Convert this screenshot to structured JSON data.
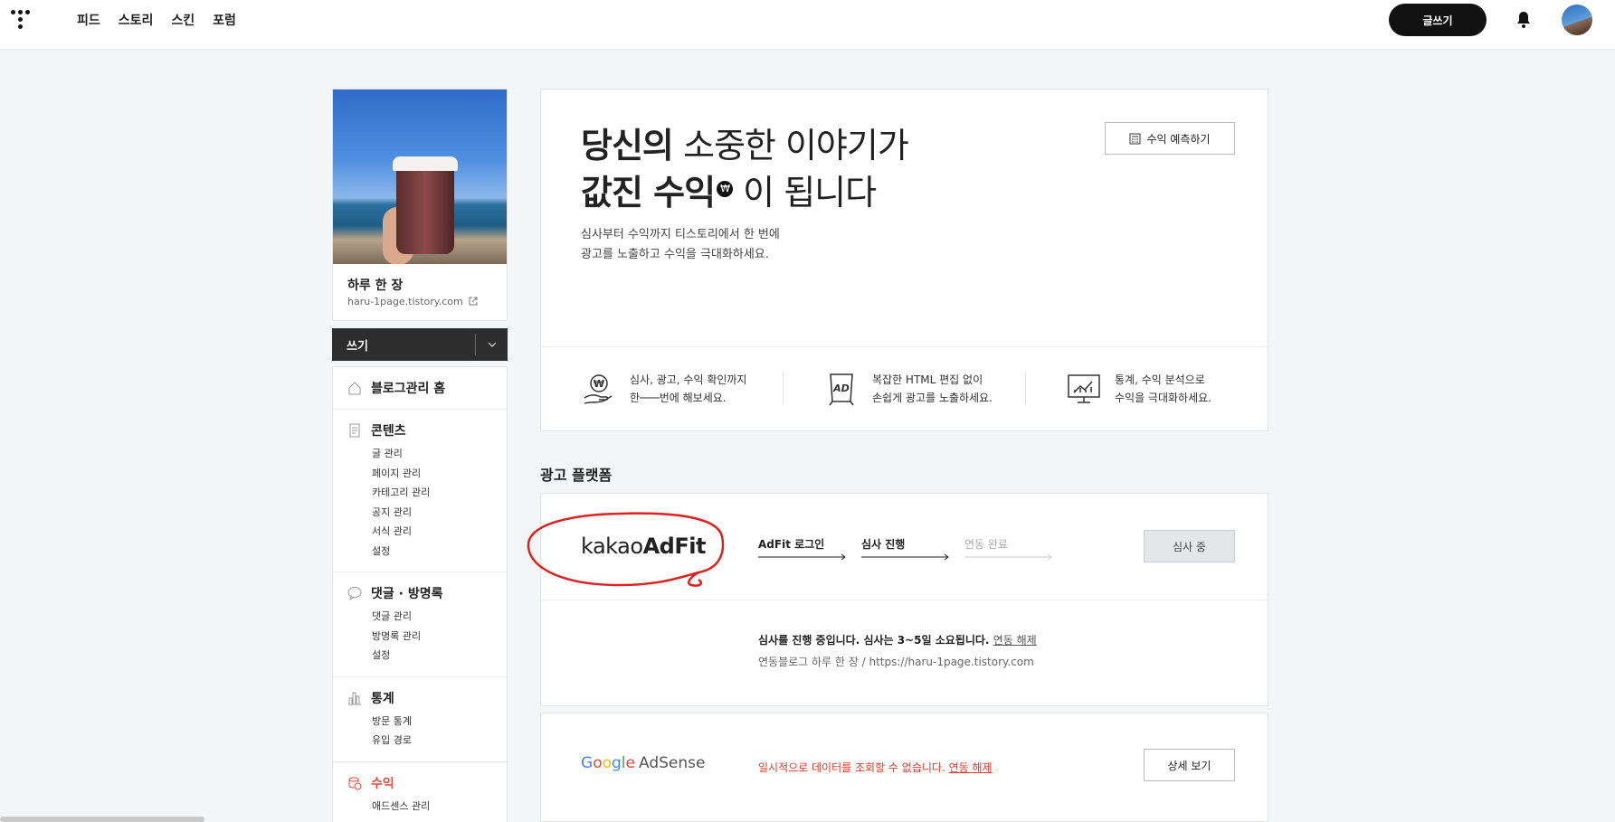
{
  "topbar": {
    "nav": [
      "피드",
      "스토리",
      "스킨",
      "포럼"
    ],
    "write_label": "글쓰기"
  },
  "blog": {
    "name": "하루 한 장",
    "url": "haru-1page.tistory.com"
  },
  "compose": {
    "label": "쓰기"
  },
  "menu": {
    "home": "블로그관리 홈",
    "contents": {
      "title": "콘텐츠",
      "items": [
        "글 관리",
        "페이지 관리",
        "카테고리 관리",
        "공지 관리",
        "서식 관리",
        "설정"
      ]
    },
    "comments": {
      "title": "댓글 · 방명록",
      "items": [
        "댓글 관리",
        "방명록 관리",
        "설정"
      ]
    },
    "stats": {
      "title": "통계",
      "items": [
        "방문 통계",
        "유입 경로"
      ]
    },
    "revenue": {
      "title": "수익",
      "items": [
        "애드센스 관리"
      ]
    }
  },
  "hero": {
    "line1_bold": "당신의",
    "line1_light": "소중한 이야기가",
    "line2_bold": "값진 수익",
    "line2_light": "이 됩니다",
    "won_symbol": "₩",
    "sub1": "심사부터 수익까지 티스토리에서 한 번에",
    "sub2": "광고를 노출하고 수익을 극대화하세요.",
    "predict_button": "수익 예측하기",
    "features": [
      {
        "line1": "심사, 광고, 수익 확인까지",
        "line2": "한───번에 해보세요."
      },
      {
        "line1": "복잡한 HTML 편집 없이",
        "line2": "손쉽게 광고를 노출하세요."
      },
      {
        "line1": "통계, 수익 분석으로",
        "line2": "수익을 극대화하세요."
      }
    ]
  },
  "platforms": {
    "section_title": "광고 플랫폼",
    "adfit": {
      "logo_light": "kakao",
      "logo_bold": "AdFit",
      "steps": [
        "AdFit 로그인",
        "심사 진행",
        "연동 완료"
      ],
      "status_button": "심사 중",
      "message": "심사를 진행 중입니다. 심사는 3~5일 소요됩니다.",
      "unlink": "연동 해제",
      "meta": "연동블로그 하루 한 장 / https://haru-1page.tistory.com"
    },
    "adsense": {
      "logo_g": [
        "G",
        "o",
        "o",
        "g",
        "l",
        "e"
      ],
      "logo_product": "AdSense",
      "message": "일시적으로 데이터를 조회할 수 없습니다.",
      "unlink": "연동 해제",
      "detail_button": "상세 보기"
    }
  },
  "colors": {
    "accent_red": "#e84a3f",
    "annotation_red": "#e02020",
    "dark": "#111111"
  }
}
